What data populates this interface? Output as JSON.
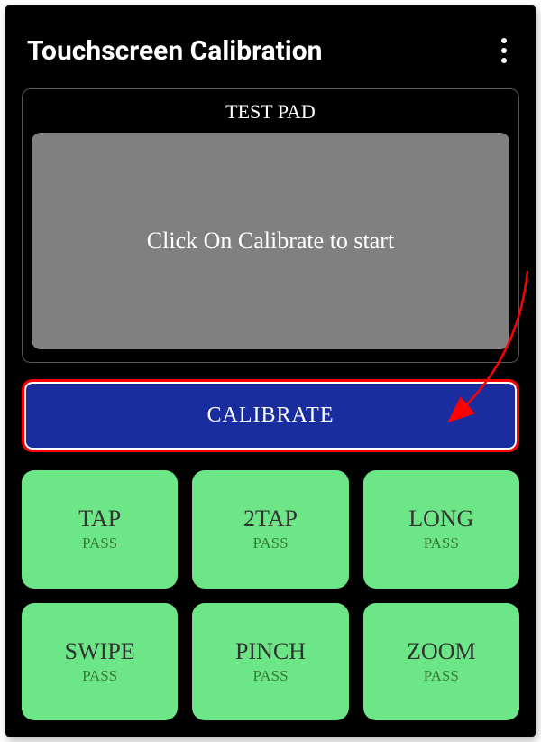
{
  "header": {
    "title": "Touchscreen Calibration"
  },
  "testPad": {
    "label": "TEST PAD",
    "instruction": "Click On Calibrate to start"
  },
  "calibrate": {
    "label": "CALIBRATE"
  },
  "tiles": [
    {
      "label": "TAP",
      "status": "PASS"
    },
    {
      "label": "2TAP",
      "status": "PASS"
    },
    {
      "label": "LONG",
      "status": "PASS"
    },
    {
      "label": "SWIPE",
      "status": "PASS"
    },
    {
      "label": "PINCH",
      "status": "PASS"
    },
    {
      "label": "ZOOM",
      "status": "PASS"
    }
  ]
}
